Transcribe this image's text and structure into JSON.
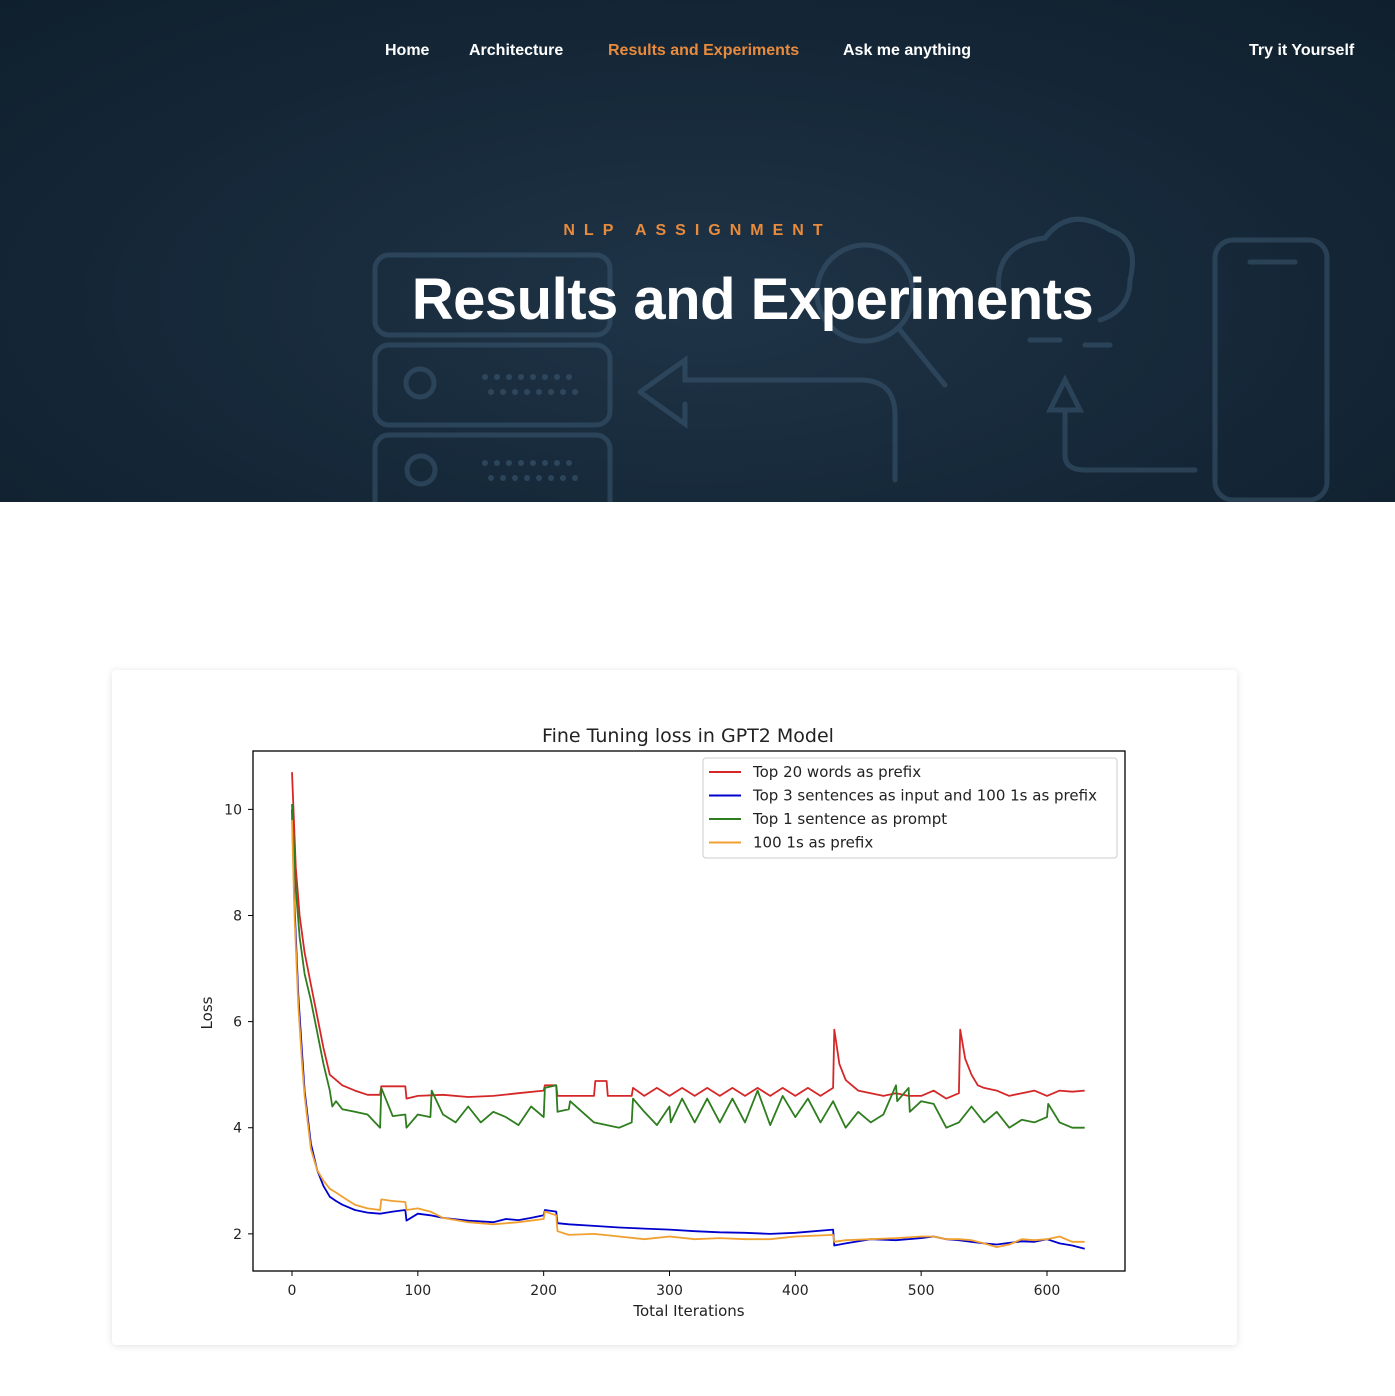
{
  "nav": {
    "items": [
      {
        "label": "Home",
        "active": false
      },
      {
        "label": "Architecture",
        "active": false
      },
      {
        "label": "Results and Experiments",
        "active": true
      },
      {
        "label": "Ask me anything",
        "active": false
      }
    ],
    "cta_label": "Try it Yourself"
  },
  "hero": {
    "eyebrow": "NLP ASSIGNMENT",
    "title": "Results and Experiments"
  },
  "colors": {
    "accent": "#e98b3c",
    "hero_bg": "#172a3b"
  },
  "chart_data": {
    "type": "line",
    "title": "Fine Tuning loss in GPT2 Model",
    "xlabel": "Total Iterations",
    "ylabel": "Loss",
    "xlim": [
      -31,
      662
    ],
    "ylim": [
      1.3,
      11.1
    ],
    "xticks": [
      0,
      100,
      200,
      300,
      400,
      500,
      600
    ],
    "yticks": [
      2,
      4,
      6,
      8,
      10
    ],
    "legend_position": "top-right",
    "grid": false,
    "series": [
      {
        "name": "Top 20 words as prefix",
        "color": "#d62728",
        "x": [
          0,
          3,
          6,
          10,
          15,
          20,
          25,
          30,
          40,
          50,
          60,
          70,
          71,
          90,
          91,
          100,
          120,
          140,
          160,
          180,
          200,
          201,
          210,
          211,
          240,
          241,
          250,
          251,
          270,
          271,
          280,
          290,
          300,
          310,
          320,
          330,
          340,
          350,
          360,
          370,
          380,
          390,
          400,
          410,
          420,
          430,
          431,
          435,
          440,
          445,
          450,
          460,
          470,
          480,
          490,
          500,
          510,
          520,
          530,
          531,
          535,
          540,
          545,
          550,
          560,
          570,
          580,
          590,
          600,
          610,
          620,
          630
        ],
        "y": [
          10.7,
          8.9,
          8.0,
          7.3,
          6.7,
          6.1,
          5.5,
          5.0,
          4.8,
          4.7,
          4.62,
          4.62,
          4.78,
          4.78,
          4.55,
          4.6,
          4.62,
          4.58,
          4.6,
          4.65,
          4.7,
          4.8,
          4.8,
          4.6,
          4.6,
          4.88,
          4.88,
          4.6,
          4.6,
          4.75,
          4.6,
          4.75,
          4.6,
          4.75,
          4.6,
          4.75,
          4.6,
          4.75,
          4.6,
          4.75,
          4.6,
          4.75,
          4.6,
          4.75,
          4.6,
          4.75,
          5.85,
          5.2,
          4.9,
          4.8,
          4.7,
          4.65,
          4.6,
          4.65,
          4.6,
          4.6,
          4.7,
          4.55,
          4.65,
          5.85,
          5.3,
          5.0,
          4.8,
          4.75,
          4.7,
          4.6,
          4.65,
          4.7,
          4.6,
          4.7,
          4.68,
          4.7
        ]
      },
      {
        "name": "Top 3 sentences as input and 100 1s as prefix",
        "color": "#0000cd",
        "x": [
          0,
          2,
          5,
          8,
          10,
          12,
          15,
          20,
          25,
          30,
          35,
          40,
          50,
          60,
          70,
          80,
          90,
          91,
          100,
          110,
          120,
          140,
          160,
          170,
          180,
          190,
          200,
          201,
          210,
          211,
          220,
          240,
          260,
          280,
          300,
          320,
          340,
          360,
          380,
          400,
          430,
          431,
          440,
          460,
          480,
          500,
          510,
          520,
          530,
          540,
          550,
          560,
          570,
          580,
          590,
          600,
          610,
          620,
          630
        ],
        "y": [
          10.0,
          8.2,
          6.5,
          5.4,
          4.7,
          4.3,
          3.7,
          3.2,
          2.9,
          2.7,
          2.62,
          2.55,
          2.45,
          2.4,
          2.38,
          2.42,
          2.45,
          2.25,
          2.38,
          2.35,
          2.3,
          2.25,
          2.22,
          2.28,
          2.26,
          2.3,
          2.35,
          2.45,
          2.42,
          2.2,
          2.18,
          2.15,
          2.12,
          2.1,
          2.08,
          2.05,
          2.03,
          2.02,
          2.0,
          2.02,
          2.08,
          1.78,
          1.82,
          1.9,
          1.88,
          1.92,
          1.95,
          1.9,
          1.88,
          1.85,
          1.82,
          1.8,
          1.83,
          1.86,
          1.85,
          1.9,
          1.82,
          1.78,
          1.72
        ]
      },
      {
        "name": "Top 1 sentence as prompt",
        "color": "#2e7d1e",
        "x": [
          0,
          3,
          6,
          10,
          15,
          20,
          25,
          30,
          32,
          35,
          40,
          50,
          60,
          70,
          71,
          80,
          90,
          91,
          100,
          110,
          111,
          120,
          130,
          140,
          150,
          160,
          170,
          180,
          190,
          200,
          201,
          210,
          211,
          220,
          221,
          240,
          260,
          270,
          271,
          280,
          290,
          300,
          301,
          310,
          320,
          330,
          340,
          350,
          360,
          370,
          380,
          390,
          400,
          410,
          420,
          430,
          440,
          450,
          460,
          470,
          480,
          481,
          490,
          491,
          500,
          510,
          520,
          530,
          540,
          550,
          560,
          570,
          580,
          590,
          600,
          601,
          610,
          620,
          630
        ],
        "y": [
          10.1,
          8.5,
          7.6,
          6.9,
          6.4,
          5.8,
          5.2,
          4.7,
          4.4,
          4.5,
          4.35,
          4.3,
          4.25,
          4.0,
          4.75,
          4.22,
          4.25,
          4.0,
          4.25,
          4.2,
          4.7,
          4.25,
          4.1,
          4.4,
          4.1,
          4.3,
          4.2,
          4.05,
          4.4,
          4.2,
          4.75,
          4.8,
          4.3,
          4.35,
          4.5,
          4.1,
          4.0,
          4.1,
          4.55,
          4.3,
          4.05,
          4.4,
          4.1,
          4.55,
          4.1,
          4.55,
          4.1,
          4.55,
          4.1,
          4.7,
          4.05,
          4.6,
          4.2,
          4.55,
          4.1,
          4.5,
          4.0,
          4.3,
          4.1,
          4.25,
          4.8,
          4.5,
          4.75,
          4.3,
          4.5,
          4.45,
          4.0,
          4.1,
          4.4,
          4.1,
          4.3,
          4.0,
          4.15,
          4.1,
          4.2,
          4.45,
          4.1,
          4.0,
          4.0
        ]
      },
      {
        "name": "100 1s as prefix",
        "color": "#f0a030",
        "x": [
          0,
          2,
          5,
          8,
          10,
          12,
          15,
          20,
          25,
          30,
          35,
          40,
          50,
          60,
          70,
          71,
          80,
          90,
          91,
          100,
          110,
          120,
          140,
          160,
          180,
          200,
          201,
          210,
          211,
          220,
          240,
          260,
          280,
          300,
          320,
          340,
          360,
          380,
          400,
          430,
          431,
          440,
          460,
          480,
          500,
          510,
          520,
          530,
          540,
          550,
          560,
          570,
          580,
          590,
          600,
          610,
          620,
          630
        ],
        "y": [
          9.8,
          8.0,
          6.3,
          5.2,
          4.6,
          4.2,
          3.6,
          3.2,
          3.0,
          2.85,
          2.78,
          2.7,
          2.55,
          2.48,
          2.45,
          2.65,
          2.62,
          2.6,
          2.45,
          2.48,
          2.42,
          2.3,
          2.22,
          2.18,
          2.22,
          2.28,
          2.42,
          2.35,
          2.05,
          1.98,
          2.0,
          1.95,
          1.9,
          1.95,
          1.9,
          1.92,
          1.9,
          1.9,
          1.95,
          1.98,
          1.85,
          1.88,
          1.9,
          1.92,
          1.95,
          1.95,
          1.9,
          1.9,
          1.88,
          1.82,
          1.75,
          1.8,
          1.9,
          1.88,
          1.9,
          1.95,
          1.85,
          1.85
        ]
      }
    ]
  }
}
